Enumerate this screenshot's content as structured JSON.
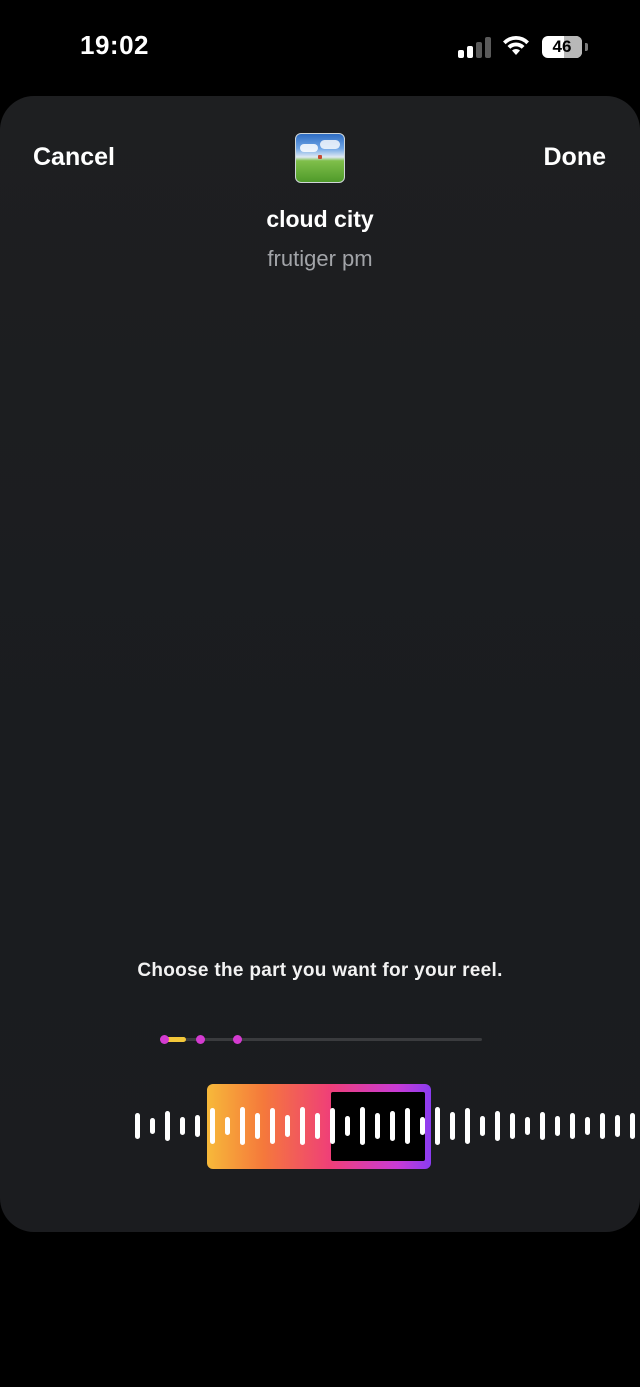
{
  "status_bar": {
    "time": "19:02",
    "battery": "46",
    "icons": [
      "signal-icon",
      "wifi-icon",
      "battery-icon"
    ]
  },
  "header": {
    "cancel_label": "Cancel",
    "done_label": "Done"
  },
  "track": {
    "title": "cloud city",
    "artist": "frutiger pm"
  },
  "instruction": "Choose the part you want for your reel.",
  "colors": {
    "progress_fill": "#f3c73a",
    "progress_dot": "#d43bd0",
    "selector_gradient": [
      "#f7b93a",
      "#f5793b",
      "#ef3f78",
      "#c83bd6",
      "#8a3cf0"
    ]
  }
}
